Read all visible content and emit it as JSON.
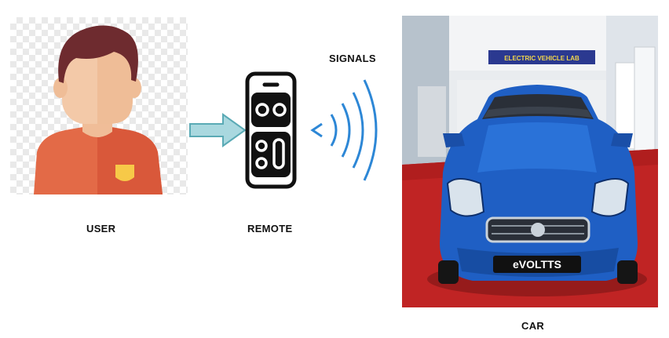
{
  "labels": {
    "user": "USER",
    "remote": "REMOTE",
    "signals": "SIGNALS",
    "car": "CAR"
  },
  "car_photo": {
    "banner_text": "ELECTRIC VEHICLE LAB",
    "banner_small_text": "LAB",
    "plate_text": "eVOLTTS"
  },
  "colors": {
    "arrow_fill": "#a9d8df",
    "arrow_stroke": "#5aaab5",
    "signal_waves": "#2d87d6",
    "car_body": "#1f5fc4",
    "carpet": "#c02424",
    "user_shirt": "#e36a47",
    "user_skin": "#f3c9a8",
    "user_hair": "#6e2b2f"
  },
  "icons": {
    "user": "user-avatar-icon",
    "remote": "remote-control-icon",
    "signals": "wireless-signal-icon",
    "arrow": "arrow-right-icon"
  }
}
